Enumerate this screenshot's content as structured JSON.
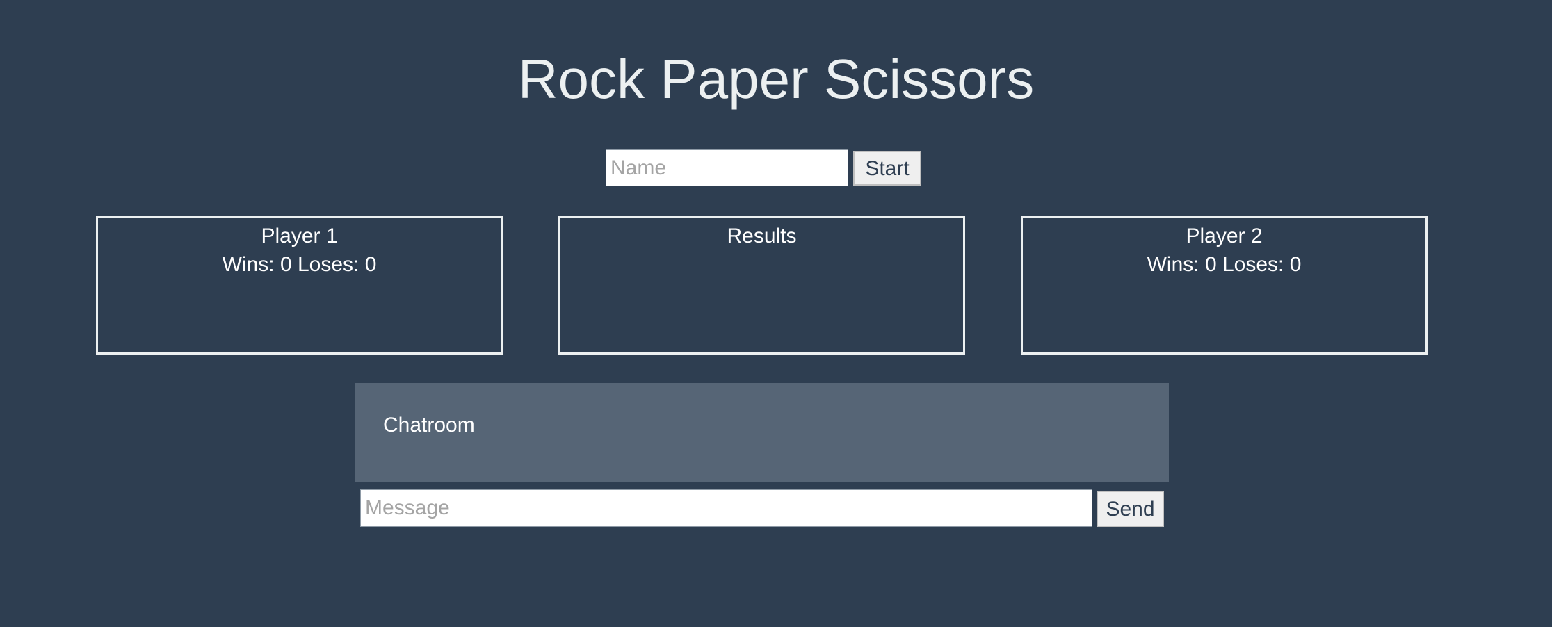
{
  "header": {
    "title": "Rock Paper Scissors"
  },
  "join": {
    "name_placeholder": "Name",
    "start_label": "Start"
  },
  "panels": {
    "player1": {
      "title": "Player 1",
      "stats": "Wins: 0 Loses: 0"
    },
    "results": {
      "title": "Results"
    },
    "player2": {
      "title": "Player 2",
      "stats": "Wins: 0 Loses: 0"
    }
  },
  "chat": {
    "title": "Chatroom",
    "message_placeholder": "Message",
    "send_label": "Send"
  },
  "colors": {
    "background": "#2e3e51",
    "chat_background": "#566576",
    "panel_border": "#ecf0f1",
    "button_background": "#efefef"
  }
}
